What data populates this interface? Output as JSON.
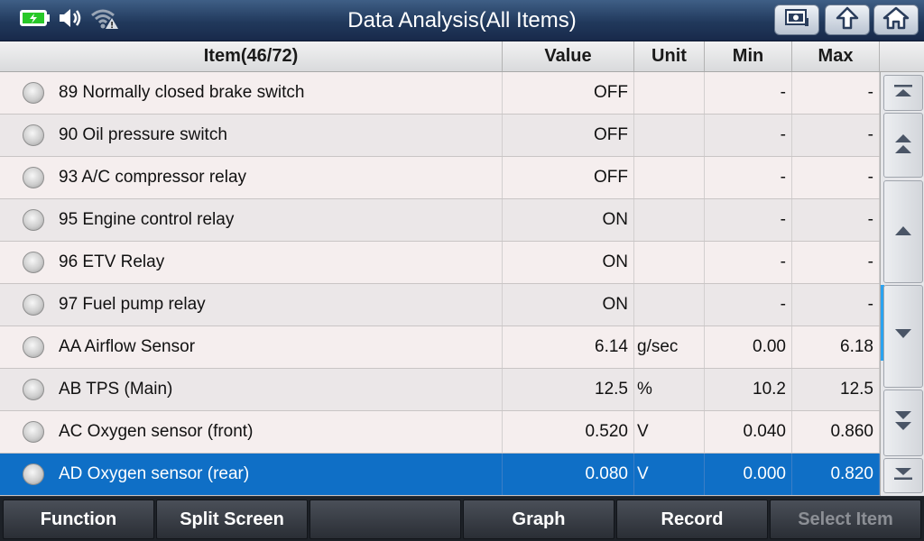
{
  "header": {
    "title": "Data Analysis(All Items)"
  },
  "colors": {
    "selected_row": "#0f6fc6",
    "row_odd": "#f5eeee",
    "row_even": "#ebe7e8",
    "scroll_thumb": "#2aa3f0"
  },
  "table": {
    "item_header": "Item(46/72)",
    "value_header": "Value",
    "unit_header": "Unit",
    "min_header": "Min",
    "max_header": "Max",
    "rows": [
      {
        "name": "89 Normally closed brake switch",
        "value": "OFF",
        "unit": "",
        "min": "-",
        "max": "-"
      },
      {
        "name": "90 Oil pressure switch",
        "value": "OFF",
        "unit": "",
        "min": "-",
        "max": "-"
      },
      {
        "name": "93 A/C compressor relay",
        "value": "OFF",
        "unit": "",
        "min": "-",
        "max": "-"
      },
      {
        "name": "95 Engine control relay",
        "value": "ON",
        "unit": "",
        "min": "-",
        "max": "-"
      },
      {
        "name": "96 ETV Relay",
        "value": "ON",
        "unit": "",
        "min": "-",
        "max": "-"
      },
      {
        "name": "97 Fuel pump relay",
        "value": "ON",
        "unit": "",
        "min": "-",
        "max": "-"
      },
      {
        "name": "AA Airflow Sensor",
        "value": "6.14",
        "unit": "g/sec",
        "min": "0.00",
        "max": "6.18"
      },
      {
        "name": "AB TPS (Main)",
        "value": "12.5",
        "unit": "%",
        "min": "10.2",
        "max": "12.5"
      },
      {
        "name": "AC Oxygen sensor (front)",
        "value": "0.520",
        "unit": "V",
        "min": "0.040",
        "max": "0.860"
      },
      {
        "name": "AD Oxygen sensor (rear)",
        "value": "0.080",
        "unit": "V",
        "min": "0.000",
        "max": "0.820",
        "selected": true
      }
    ]
  },
  "footer": {
    "function_label": "Function",
    "split_screen_label": "Split Screen",
    "graph_label": "Graph",
    "record_label": "Record",
    "select_item_label": "Select Item"
  }
}
